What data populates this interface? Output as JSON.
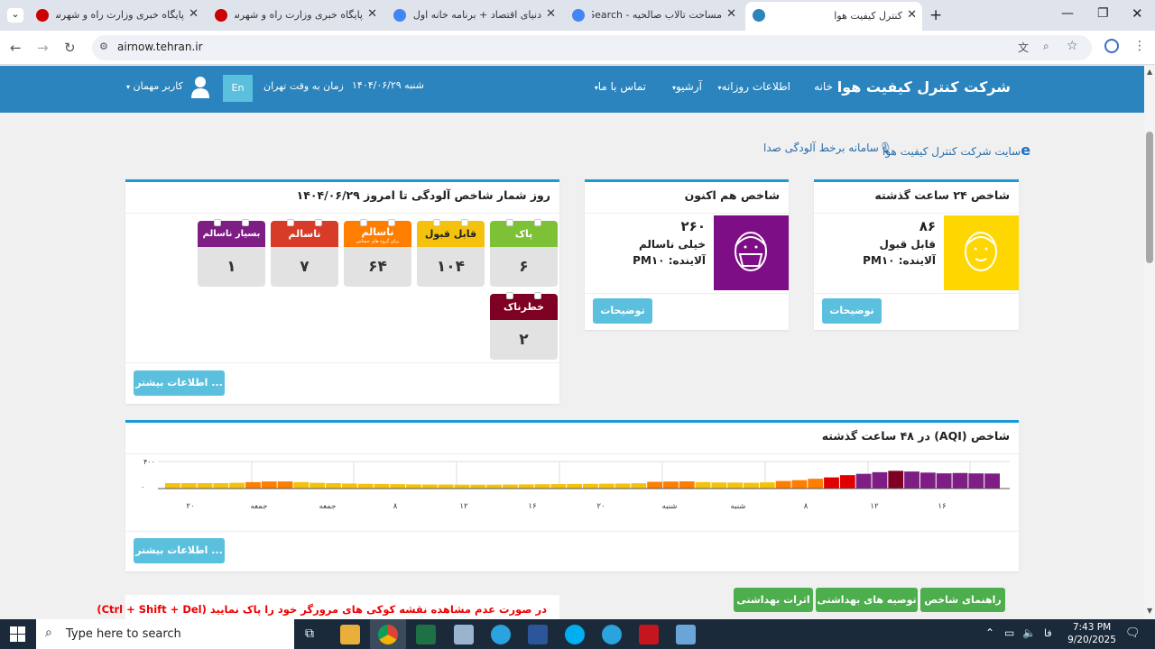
{
  "browser": {
    "tabs": [
      {
        "title": "پایگاه خبری وزارت راه و شهرسازی",
        "fav": "#c00"
      },
      {
        "title": "پایگاه خبری وزارت راه و شهرسازی",
        "fav": "#c00"
      },
      {
        "title": "دنیای اقتصاد + برنامه خانه اول + ...",
        "fav": "#4285f4"
      },
      {
        "title": "مساحت تالاب صالحیه - Search",
        "fav": "#4285f4"
      },
      {
        "title": "کنترل کیفیت هوا",
        "fav": "#2b84bd"
      }
    ],
    "url": "airnow.tehran.ir"
  },
  "header": {
    "brand": "شرکت کنترل کیفیت هوا",
    "nav": [
      "خانه",
      "اطلاعات روزانه",
      "آرشیو",
      "تماس با ما"
    ],
    "date": "شنبه ۱۴۰۴/۰۶/۲۹",
    "time_label": "زمان به وقت تهران",
    "lang": "En",
    "user": "کاربر مهمان"
  },
  "links": {
    "voice": "سامانه برخط آلودگی صدا",
    "site": "سایت شرکت کنترل کیفیت هوا"
  },
  "panel24": {
    "title": "شاخص ۲۴ ساعت گذشته",
    "value": "۸۶",
    "status": "قابل قبول",
    "pollutant": "آلاینده: PM۱۰",
    "button": "توضیحات",
    "color": "#ffd700"
  },
  "panelNow": {
    "title": "شاخص هم اکنون",
    "value": "۲۶۰",
    "status": "خیلی ناسالم",
    "pollutant": "آلاینده: PM۱۰",
    "button": "توضیحات",
    "color": "#7e0e85"
  },
  "counter": {
    "title": "روز شمار شاخص آلودگی تا امروز ۱۴۰۴/۰۶/۲۹",
    "cards": [
      {
        "label": "پاک",
        "value": "۶",
        "color": "#7cc136"
      },
      {
        "label": "قابل قبول",
        "value": "۱۰۴",
        "color": "#f4c20d"
      },
      {
        "label": "ناسالم",
        "sub": "برای گروه های حساس",
        "value": "۶۴",
        "color": "#ff7e00"
      },
      {
        "label": "ناسالم",
        "value": "۷",
        "color": "#d63c28"
      },
      {
        "label": "بسیار ناسالم",
        "value": "۱",
        "color": "#7e1e84"
      },
      {
        "label": "خطرناک",
        "value": "۲",
        "color": "#7e0023"
      }
    ],
    "more": "اطلاعات بیشتر ..."
  },
  "aqi48": {
    "title": "شاخص (AQI) در ۴۸ ساعت گذشته",
    "more": "اطلاعات بیشتر ..."
  },
  "chart_data": {
    "type": "bar",
    "ylim": [
      0,
      400
    ],
    "ytick_labels": [
      "۴۰۰",
      "۰"
    ],
    "xtick_labels": [
      "۲۰",
      "جمعه",
      "جمعه",
      "۸",
      "۱۲",
      "۱۶",
      "۲۰",
      "شنبه",
      "شنبه",
      "۸",
      "۱۲",
      "۱۶"
    ],
    "values": [
      80,
      80,
      80,
      80,
      85,
      95,
      105,
      105,
      95,
      85,
      80,
      75,
      70,
      68,
      65,
      62,
      60,
      60,
      58,
      58,
      58,
      60,
      62,
      64,
      66,
      68,
      70,
      72,
      74,
      78,
      100,
      104,
      106,
      96,
      90,
      88,
      86,
      92,
      112,
      124,
      145,
      165,
      198,
      218,
      242,
      262,
      252,
      236,
      225,
      230,
      224,
      222
    ],
    "colors": [
      "#f4c20d",
      "#f4c20d",
      "#f4c20d",
      "#f4c20d",
      "#f4c20d",
      "#ff7e00",
      "#ff7e00",
      "#ff7e00",
      "#f4c20d",
      "#f4c20d",
      "#f4c20d",
      "#f4c20d",
      "#f4c20d",
      "#f4c20d",
      "#f4c20d",
      "#f4c20d",
      "#f4c20d",
      "#f4c20d",
      "#f4c20d",
      "#f4c20d",
      "#f4c20d",
      "#f4c20d",
      "#f4c20d",
      "#f4c20d",
      "#f4c20d",
      "#f4c20d",
      "#f4c20d",
      "#f4c20d",
      "#f4c20d",
      "#f4c20d",
      "#ff7e00",
      "#ff7e00",
      "#ff7e00",
      "#f4c20d",
      "#f4c20d",
      "#f4c20d",
      "#f4c20d",
      "#f4c20d",
      "#ff7e00",
      "#ff7e00",
      "#ff7e00",
      "#e00000",
      "#e00000",
      "#7e1e84",
      "#7e1e84",
      "#7e0023",
      "#7e1e84",
      "#7e1e84",
      "#7e1e84",
      "#7e1e84",
      "#7e1e84",
      "#7e1e84"
    ]
  },
  "healthButtons": [
    "راهنمای شاخص",
    "توصیه های بهداشتی",
    "اثرات بهداشتی"
  ],
  "notice": "در صورت عدم مشاهده نقشه کوکی های مرورگر خود را پاک نمایید (Ctrl + Shift + Del)",
  "taskbar": {
    "search": "Type here to search",
    "time": "7:43 PM",
    "date": "9/20/2025",
    "lang": "فا"
  }
}
